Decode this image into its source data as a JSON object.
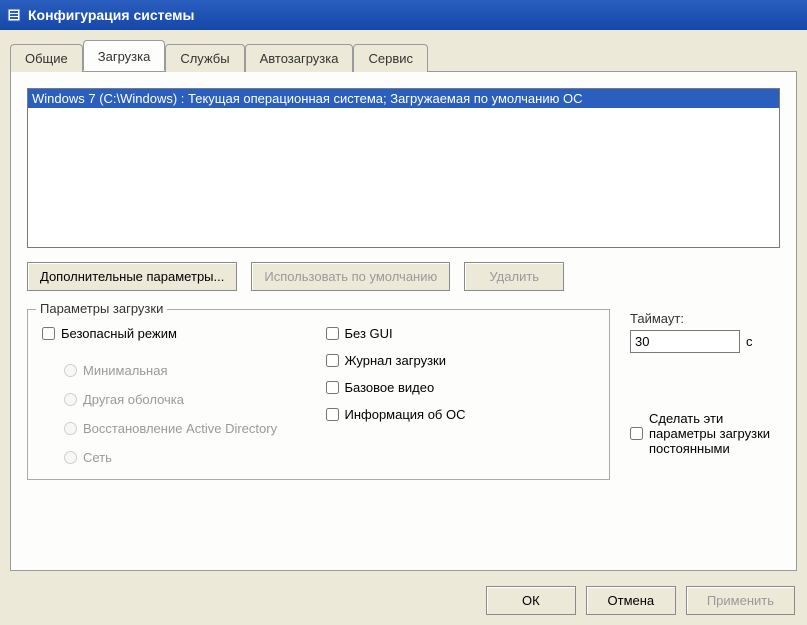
{
  "window": {
    "title": "Конфигурация системы"
  },
  "tabs": {
    "general": "Общие",
    "boot": "Загрузка",
    "services": "Службы",
    "startup": "Автозагрузка",
    "tools": "Сервис"
  },
  "boot": {
    "entry": "Windows 7 (C:\\Windows) : Текущая операционная система; Загружаемая по умолчанию ОС",
    "advanced_btn": "Дополнительные параметры...",
    "default_btn": "Использовать по умолчанию",
    "delete_btn": "Удалить"
  },
  "bootopts": {
    "legend": "Параметры загрузки",
    "safeboot": "Безопасный режим",
    "minimal": "Минимальная",
    "altshell": "Другая оболочка",
    "adrepair": "Восстановление Active Directory",
    "network": "Сеть",
    "nogui": "Без GUI",
    "bootlog": "Журнал загрузки",
    "basevideo": "Базовое видео",
    "osinfo": "Информация об ОС"
  },
  "timeout": {
    "label": "Таймаут:",
    "value": "30",
    "unit": "с"
  },
  "persist": {
    "label": "Сделать эти параметры загрузки постоянными"
  },
  "footer": {
    "ok": "ОК",
    "cancel": "Отмена",
    "apply": "Применить"
  }
}
